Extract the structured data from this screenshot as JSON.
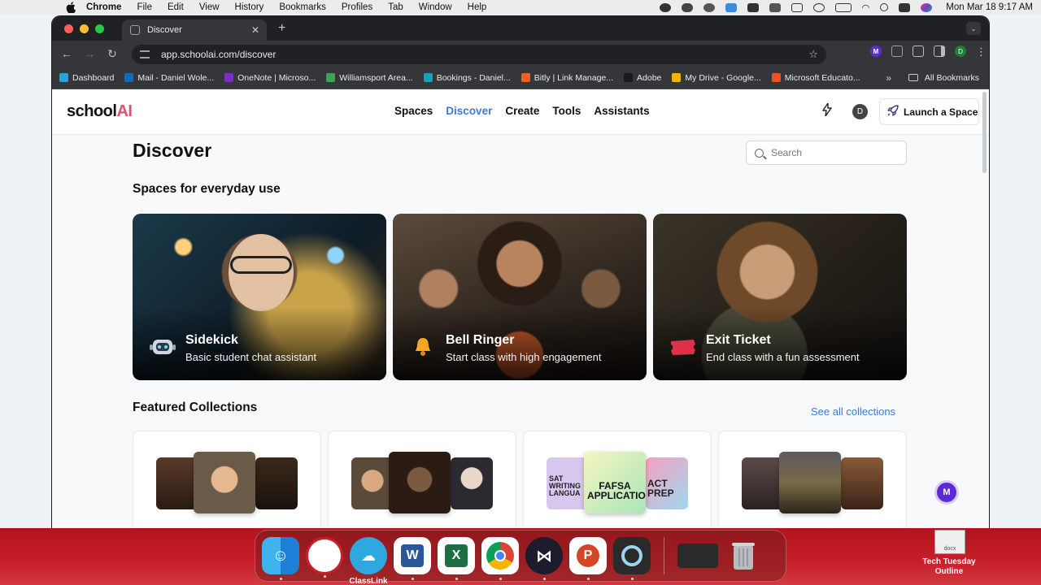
{
  "menubar": {
    "app": "Chrome",
    "items": [
      "File",
      "Edit",
      "View",
      "History",
      "Bookmarks",
      "Profiles",
      "Tab",
      "Window",
      "Help"
    ],
    "clock": "Mon Mar 18  9:17 AM"
  },
  "browser": {
    "tab_title": "Discover",
    "url": "app.schoolai.com/discover",
    "profile_initial": "D",
    "bookmarks": [
      {
        "label": "Dashboard",
        "color": "#29a3d8"
      },
      {
        "label": "Mail - Daniel Wole...",
        "color": "#0f6cbd"
      },
      {
        "label": "OneNote | Microso...",
        "color": "#7b2fbe"
      },
      {
        "label": "Williamsport Area...",
        "color": "#3aa655"
      },
      {
        "label": "Bookings - Daniel...",
        "color": "#13a3b8"
      },
      {
        "label": "Bitly | Link Manage...",
        "color": "#ee6123"
      },
      {
        "label": "Adobe",
        "color": "#1a1a1a"
      },
      {
        "label": "My Drive - Google...",
        "color": "#f4b400"
      },
      {
        "label": "Microsoft Educato...",
        "color": "#f25022"
      }
    ],
    "all_bookmarks": "All Bookmarks",
    "more_glyph": "»"
  },
  "site": {
    "logo_text": "school",
    "logo_accent": "AI",
    "nav": [
      {
        "label": "Spaces",
        "active": false
      },
      {
        "label": "Discover",
        "active": true
      },
      {
        "label": "Create",
        "active": false
      },
      {
        "label": "Tools",
        "active": false
      },
      {
        "label": "Assistants",
        "active": false
      }
    ],
    "avatar_initial": "D",
    "launch_label": "Launch a Space"
  },
  "discover": {
    "title": "Discover",
    "search_placeholder": "Search",
    "section_everyday": "Spaces for everyday use",
    "cards": [
      {
        "name": "Sidekick",
        "desc": "Basic student chat assistant",
        "icon": "robot-icon"
      },
      {
        "name": "Bell Ringer",
        "desc": "Start class with high engagement",
        "icon": "bell-icon"
      },
      {
        "name": "Exit Ticket",
        "desc": "End class with a fun assessment",
        "icon": "ticket-icon"
      }
    ],
    "section_featured": "Featured Collections",
    "see_all": "See all collections",
    "collection_thumbs_text": {
      "left": "SAT WRITING LANGUA",
      "center": "FAFSA APPLICATION",
      "right": "ACT PREP"
    }
  },
  "float_button": "M",
  "dock": {
    "classlink_label": "ClassLink",
    "desktop_file_label": "Tech Tuesday Outline",
    "desktop_file_ext": "docx"
  },
  "colors": {
    "accent_blue": "#3b7bd6",
    "brand_pink": "#e4506c",
    "desktop_red": "#c8202a"
  }
}
